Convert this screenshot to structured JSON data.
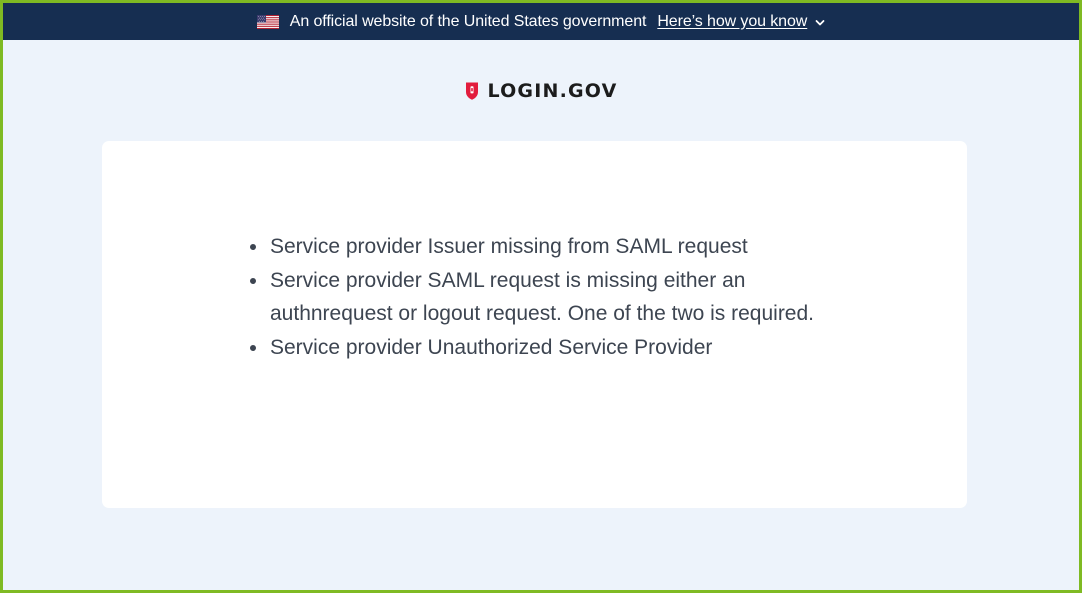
{
  "banner": {
    "official_text": "An official website of the United States government",
    "link_text": "Here’s how you know"
  },
  "logo": {
    "text": "LOGIN.GOV"
  },
  "errors": [
    "Service provider Issuer missing from SAML request",
    "Service provider SAML request is missing either an authnrequest or logout request. One of the two is required.",
    "Service provider Unauthorized Service Provider"
  ],
  "colors": {
    "banner_bg": "#162e51",
    "page_bg": "#edf3fb",
    "card_bg": "#ffffff",
    "logo_red": "#e21c3d",
    "text": "#3d4551",
    "outer_border": "#7fba23"
  },
  "icons": {
    "flag": "us-flag-icon",
    "chevron": "chevron-down-icon",
    "shield": "login-gov-shield-icon"
  }
}
